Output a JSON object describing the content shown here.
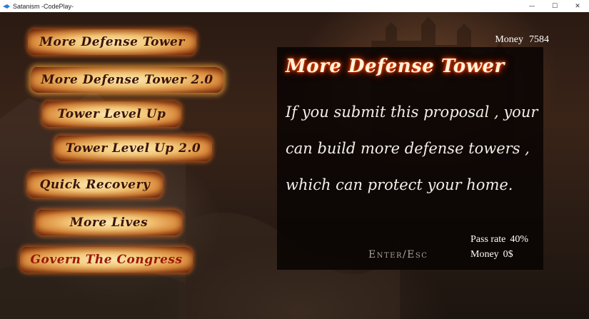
{
  "window": {
    "title": "Satanism -CodePlay-",
    "controls": {
      "minimize": "—",
      "maximize": "☐",
      "close": "✕"
    },
    "app_icon": "app-icon"
  },
  "hud": {
    "money_label": "Money",
    "money_value": "7584"
  },
  "menu": {
    "items": [
      {
        "label": "More Defense Tower"
      },
      {
        "label": "More Defense Tower 2.0"
      },
      {
        "label": "Tower Level Up"
      },
      {
        "label": "Tower Level Up 2.0"
      },
      {
        "label": "Quick Recovery"
      },
      {
        "label": "More Lives"
      },
      {
        "label": "Govern The Congress"
      }
    ]
  },
  "proposal": {
    "title": "More Defense Tower",
    "description": "If you submit this proposal , your can build more defense towers , which can protect your home.",
    "pass_rate_label": "Pass rate",
    "pass_rate_value": "40%",
    "money_label": "Money",
    "money_value": "0$",
    "action_label": "Enter/Esc"
  },
  "colors": {
    "scroll_text": "#3a140a",
    "scroll_text_alert": "#9a1608",
    "title_glow": "#ff4a00",
    "panel_bg": "#080402"
  }
}
